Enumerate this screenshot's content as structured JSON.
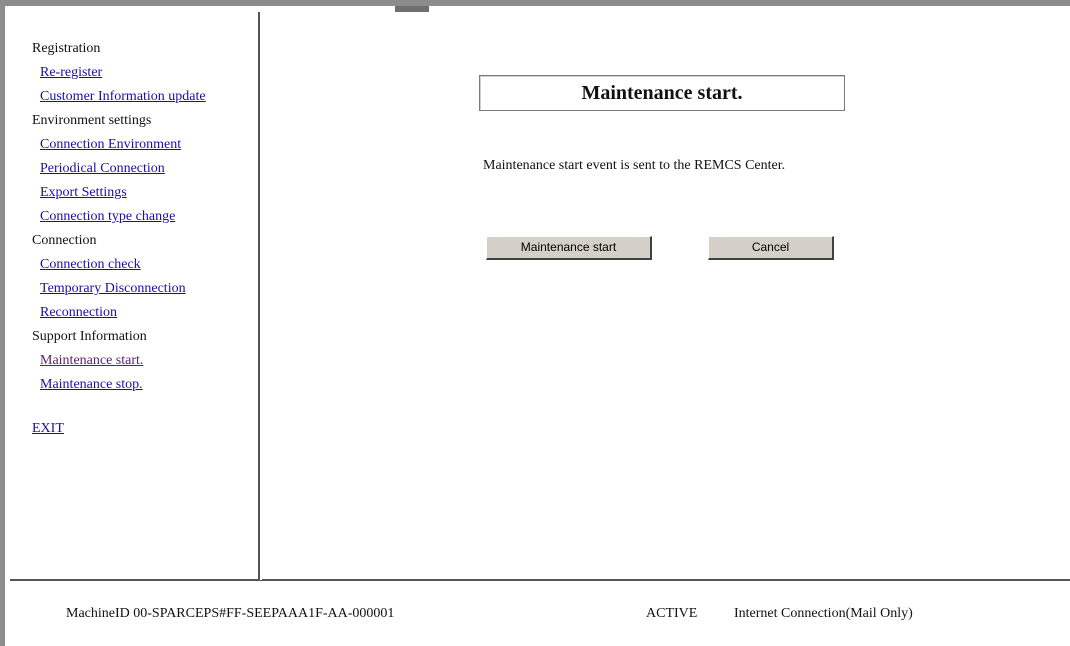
{
  "sidebar": {
    "sections": [
      {
        "title": "Registration",
        "links": [
          "Re-register",
          "Customer Information update"
        ]
      },
      {
        "title": "Environment settings",
        "links": [
          "Connection Environment",
          "Periodical Connection",
          "Export Settings",
          "Connection type change"
        ]
      },
      {
        "title": "Connection",
        "links": [
          "Connection check",
          "Temporary Disconnection",
          "Reconnection"
        ]
      },
      {
        "title": "Support Information",
        "links": [
          "Maintenance start.",
          "Maintenance stop."
        ]
      }
    ],
    "exit_label": "EXIT"
  },
  "main": {
    "title": "Maintenance start.",
    "message": "Maintenance start event is sent to the REMCS Center.",
    "start_button_label": "Maintenance start",
    "cancel_button_label": "Cancel"
  },
  "footer": {
    "machine_id": "MachineID 00-SPARCEPS#FF-SEEPAAA1F-AA-000001",
    "status": "ACTIVE",
    "connection": "Internet Connection(Mail Only)"
  },
  "colors": {
    "link": "#1a0dab",
    "visited_link": "#5a1f6e",
    "button_face": "#d4d0c8",
    "frame_border": "#8c8c8c"
  }
}
